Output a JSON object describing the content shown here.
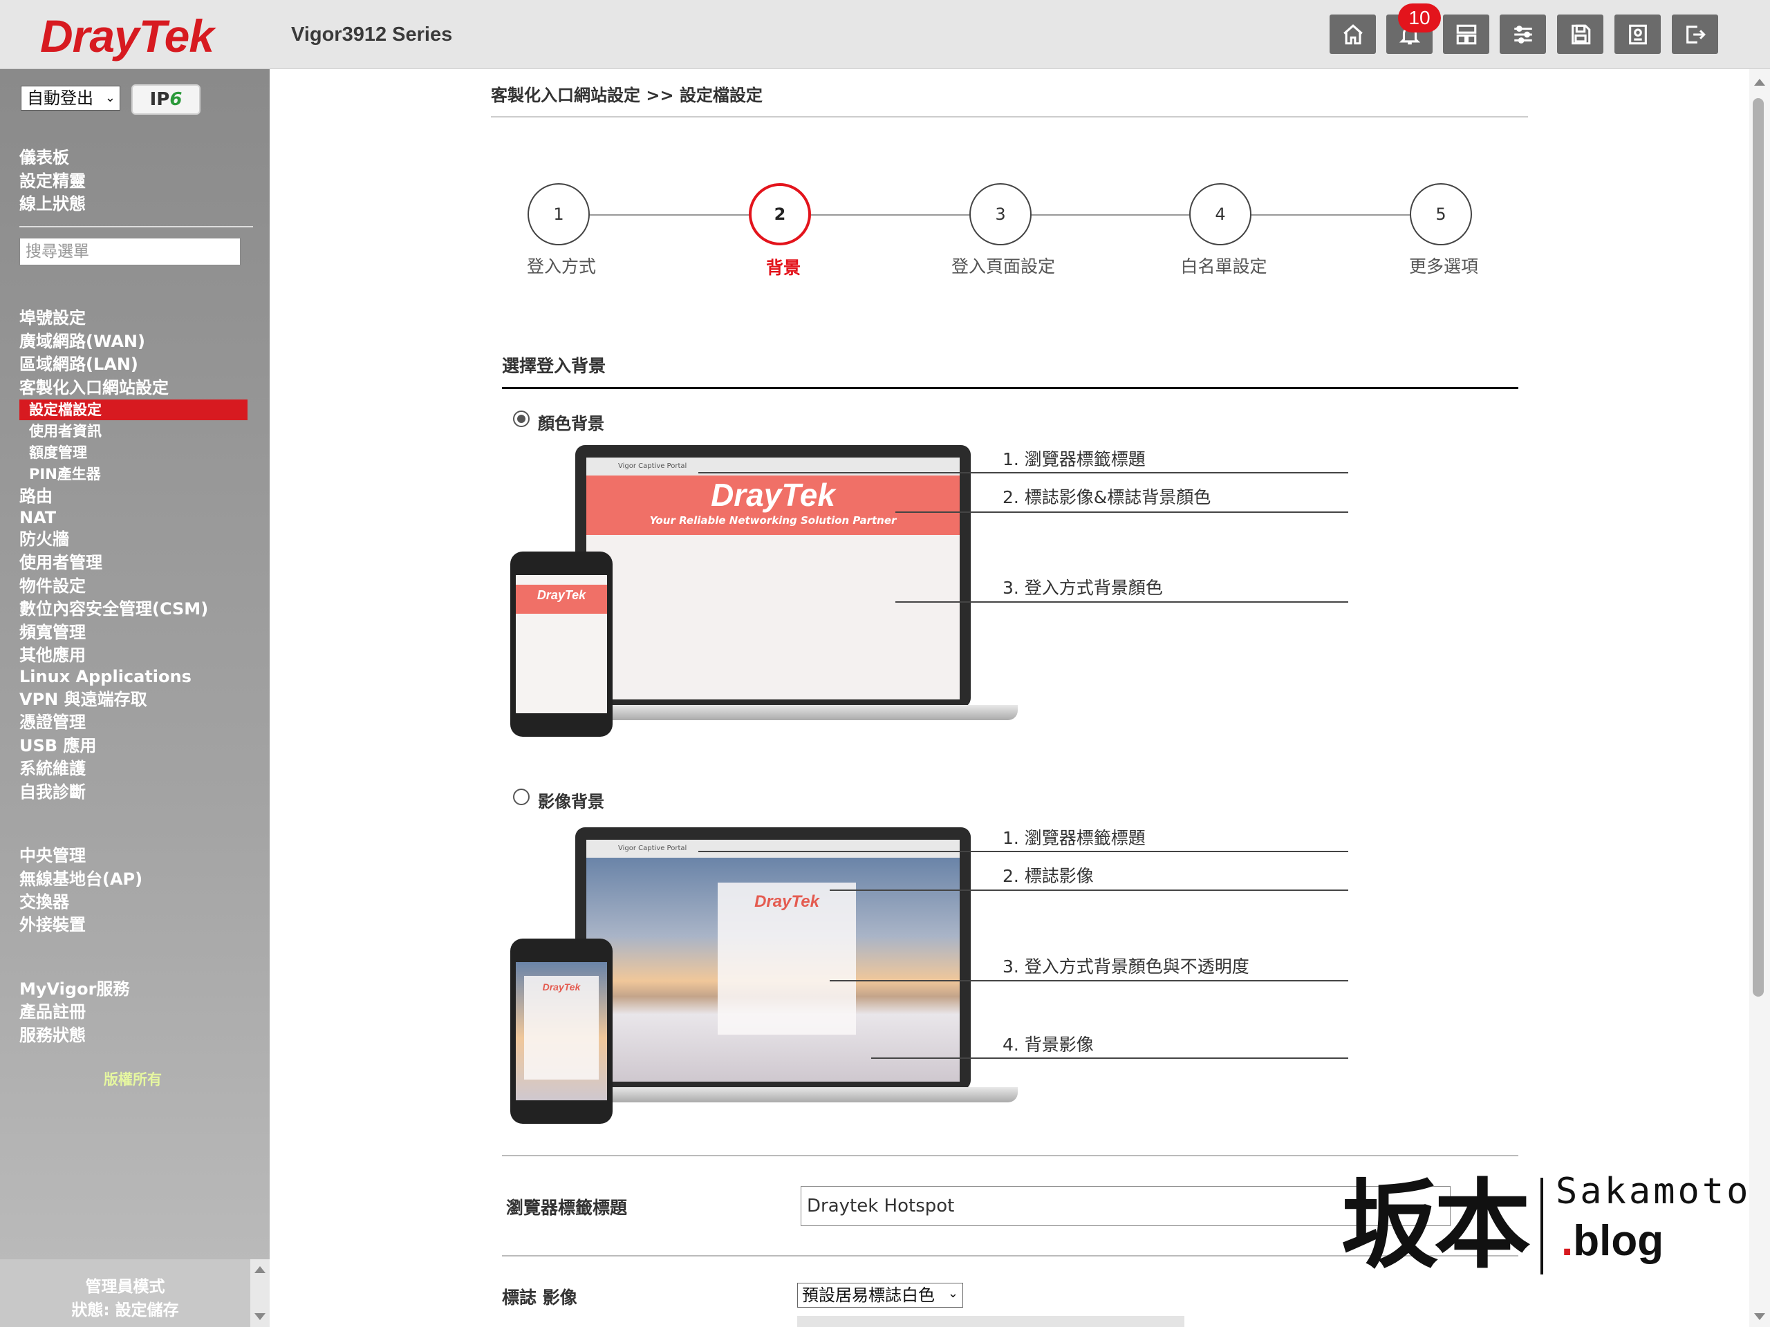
{
  "header": {
    "logo": "DrayTek",
    "model": "Vigor3912 Series",
    "notification_count": "10",
    "icons": [
      "home-icon",
      "bell-icon",
      "dashboard-layout-icon",
      "settings-sliders-icon",
      "save-icon",
      "backup-icon",
      "logout-icon"
    ]
  },
  "sidebar": {
    "logout_select": "自動登出",
    "ipv6": {
      "prefix": "IP",
      "suffix": "6"
    },
    "top_items": [
      "儀表板",
      "設定精靈",
      "線上狀態"
    ],
    "search_placeholder": "搜尋選單",
    "menu": [
      "埠號設定",
      "廣域網路(WAN)",
      "區域網路(LAN)",
      "客製化入口網站設定"
    ],
    "sub_items": [
      "設定檔設定",
      "使用者資訊",
      "額度管理",
      "PIN產生器"
    ],
    "menu2": [
      "路由",
      "NAT",
      "防火牆",
      "使用者管理",
      "物件設定",
      "數位內容安全管理(CSM)",
      "頻寬管理",
      "其他應用",
      "Linux Applications",
      "VPN 與遠端存取",
      "憑證管理",
      "USB 應用",
      "系統維護",
      "自我診斷"
    ],
    "central": [
      "中央管理",
      "無線基地台(AP)",
      "交換器",
      "外接裝置"
    ],
    "myvigor": [
      "MyVigor服務",
      "產品註冊",
      "服務狀態"
    ],
    "copyright": "版權所有",
    "admin_mode": "管理員模式",
    "status": "狀態: 設定儲存"
  },
  "main": {
    "breadcrumb": "客製化入口網站設定 >> 設定檔設定",
    "steps": [
      {
        "num": "1",
        "label": "登入方式"
      },
      {
        "num": "2",
        "label": "背景"
      },
      {
        "num": "3",
        "label": "登入頁面設定"
      },
      {
        "num": "4",
        "label": "白名單設定"
      },
      {
        "num": "5",
        "label": "更多選項"
      }
    ],
    "active_step": 2,
    "section_title": "選擇登入背景",
    "option_color": {
      "label": "顏色背景",
      "selected": true,
      "callouts": [
        "1. 瀏覽器標籤標題",
        "2. 標誌影像&標誌背景顏色",
        "3. 登入方式背景顏色"
      ]
    },
    "option_image": {
      "label": "影像背景",
      "selected": false,
      "callouts": [
        "1. 瀏覽器標籤標題",
        "2. 標誌影像",
        "3. 登入方式背景顏色與不透明度",
        "4. 背景影像"
      ]
    },
    "mockup": {
      "tab_title": "Vigor Captive Portal",
      "brand": "DrayTek",
      "tagline": "Your Reliable Networking Solution Partner"
    },
    "browser_tab_title_label": "瀏覽器標籤標題",
    "browser_tab_title_value": "Draytek Hotspot",
    "logo_image_label": "標誌 影像",
    "logo_image_select": "預設居易標誌白色"
  },
  "watermark": {
    "cjk": "坂本",
    "latin": "Sakamoto",
    "dot": ".",
    "blog": "blog"
  },
  "colors": {
    "brand_red": "#d71a20",
    "active_step": "#e3141c",
    "toolbar": "#6b6b6b",
    "banner": "#f07067"
  }
}
